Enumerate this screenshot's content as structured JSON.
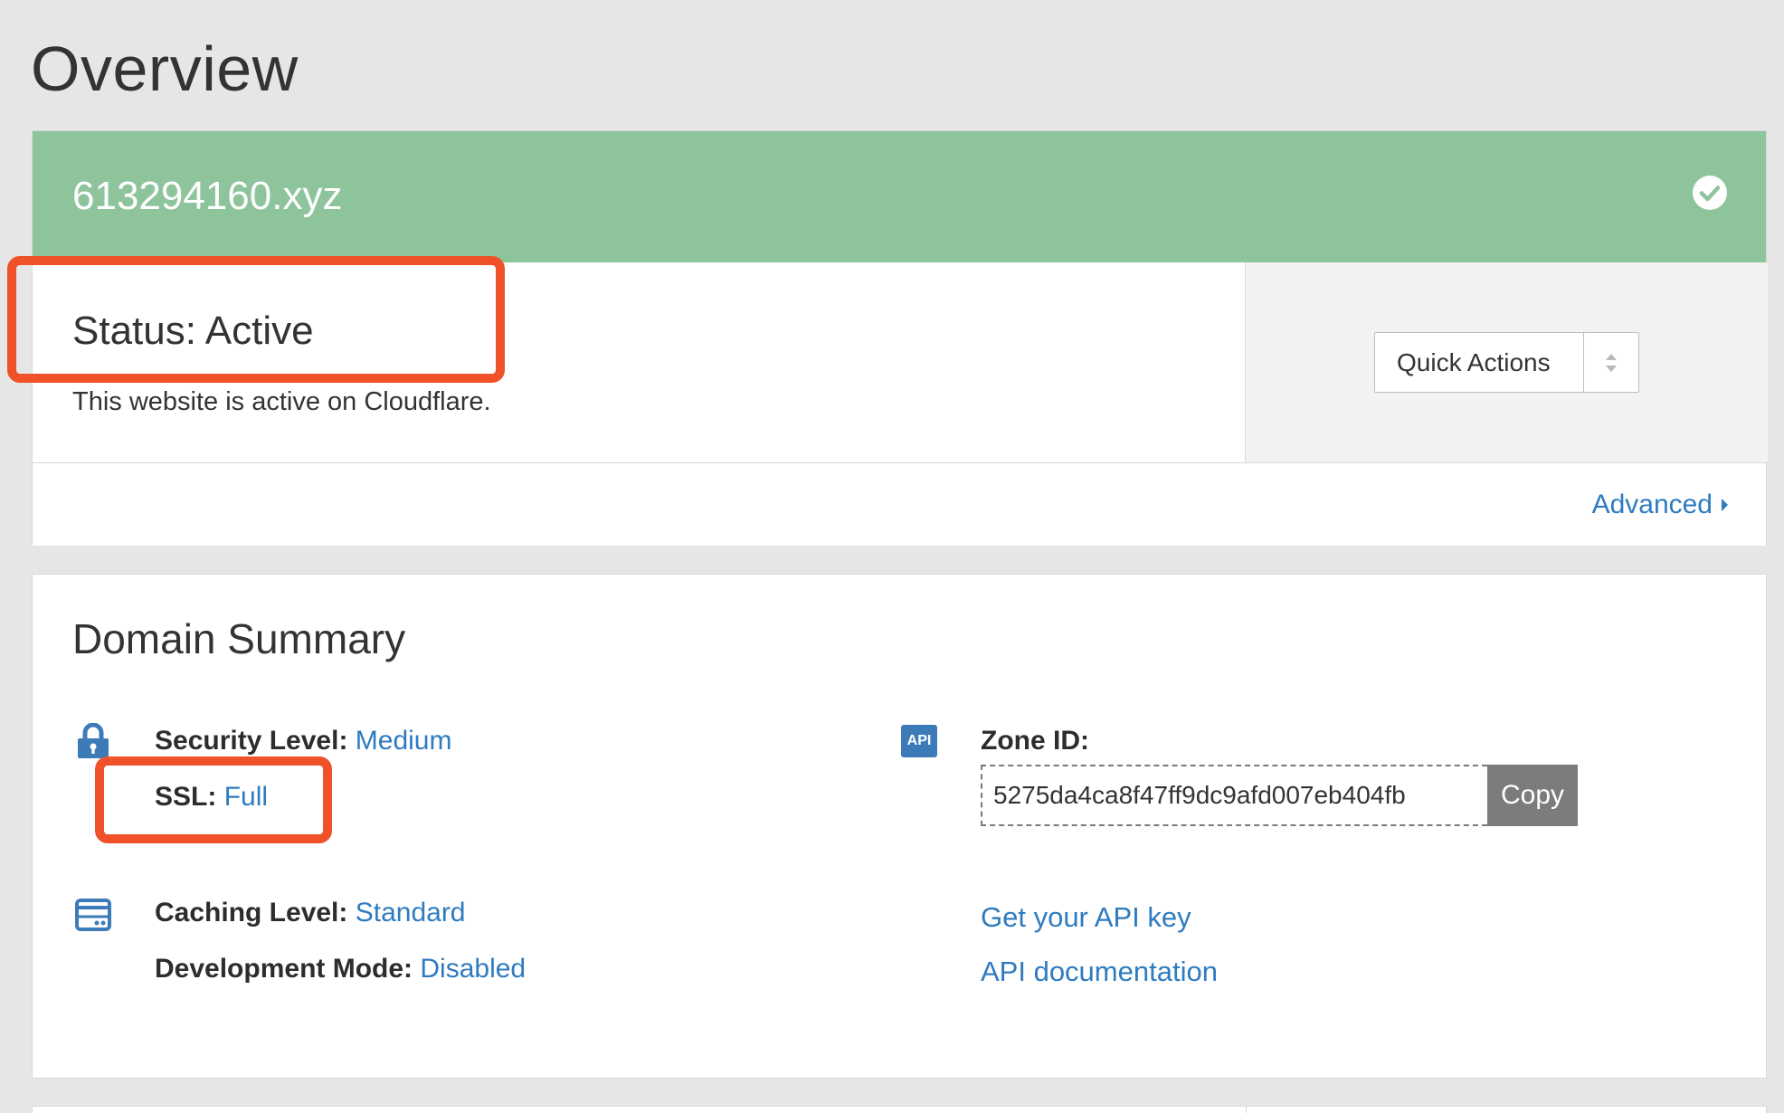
{
  "page": {
    "title": "Overview"
  },
  "status_card": {
    "domain": "613294160.xyz",
    "status_heading": "Status: Active",
    "status_description": "This website is active on Cloudflare.",
    "quick_actions_label": "Quick Actions",
    "advanced_label": "Advanced",
    "header_color": "#8dc49c"
  },
  "domain_summary": {
    "title": "Domain Summary",
    "security_level": {
      "label": "Security Level:",
      "value": "Medium"
    },
    "ssl": {
      "label": "SSL:",
      "value": "Full"
    },
    "caching_level": {
      "label": "Caching Level:",
      "value": "Standard"
    },
    "development_mode": {
      "label": "Development Mode:",
      "value": "Disabled"
    },
    "api_badge": "API",
    "zone_id": {
      "label": "Zone ID:",
      "value": "5275da4ca8f47ff9dc9afd007eb404fb",
      "copy_label": "Copy"
    },
    "links": {
      "api_key": "Get your API key",
      "api_docs": "API documentation"
    }
  },
  "colors": {
    "link": "#2f7bbf",
    "highlight": "#ef5128",
    "icon": "#3d7bb8"
  },
  "icons": [
    "check-circle-icon",
    "sort-arrows-icon",
    "caret-right-icon",
    "lock-icon",
    "api-icon",
    "server-icon"
  ]
}
